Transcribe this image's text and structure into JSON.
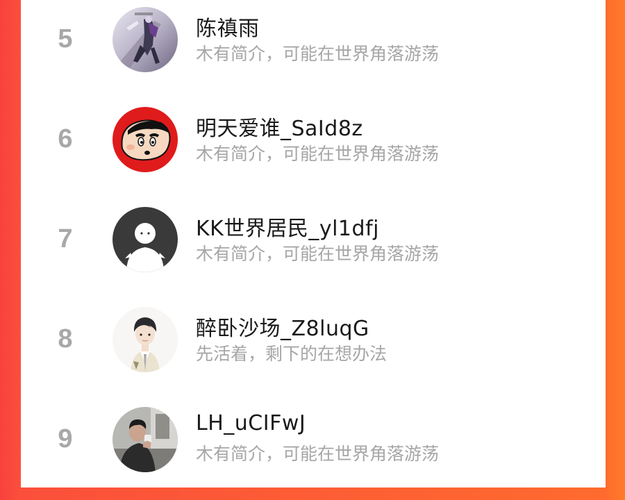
{
  "leaderboard": {
    "entries": [
      {
        "rank": "5",
        "name": "陈禛雨",
        "bio": "木有简介，可能在世界角落游荡",
        "avatar_icon": "anime-mecha-avatar"
      },
      {
        "rank": "6",
        "name": "明天爱谁_SaId8z",
        "bio": "木有简介，可能在世界角落游荡",
        "avatar_icon": "crayon-shinchan-avatar"
      },
      {
        "rank": "7",
        "name": "KK世界居民_yl1dfj",
        "bio": "木有简介，可能在世界角落游荡",
        "avatar_icon": "default-user-avatar"
      },
      {
        "rank": "8",
        "name": "醉卧沙场_Z8luqG",
        "bio": "先活着，剩下的在想办法",
        "avatar_icon": "illustrated-boy-avatar"
      },
      {
        "rank": "9",
        "name": "LH_uCIFwJ",
        "bio": "木有简介，可能在世界角落游荡",
        "avatar_icon": "photo-person-avatar"
      }
    ]
  },
  "colors": {
    "background_left": "#f9413d",
    "background_right": "#ff7a2a",
    "card": "#ffffff",
    "rank_text": "#a8a8a8",
    "name_text": "#1a1a1a",
    "bio_text": "#a6a6a6"
  }
}
